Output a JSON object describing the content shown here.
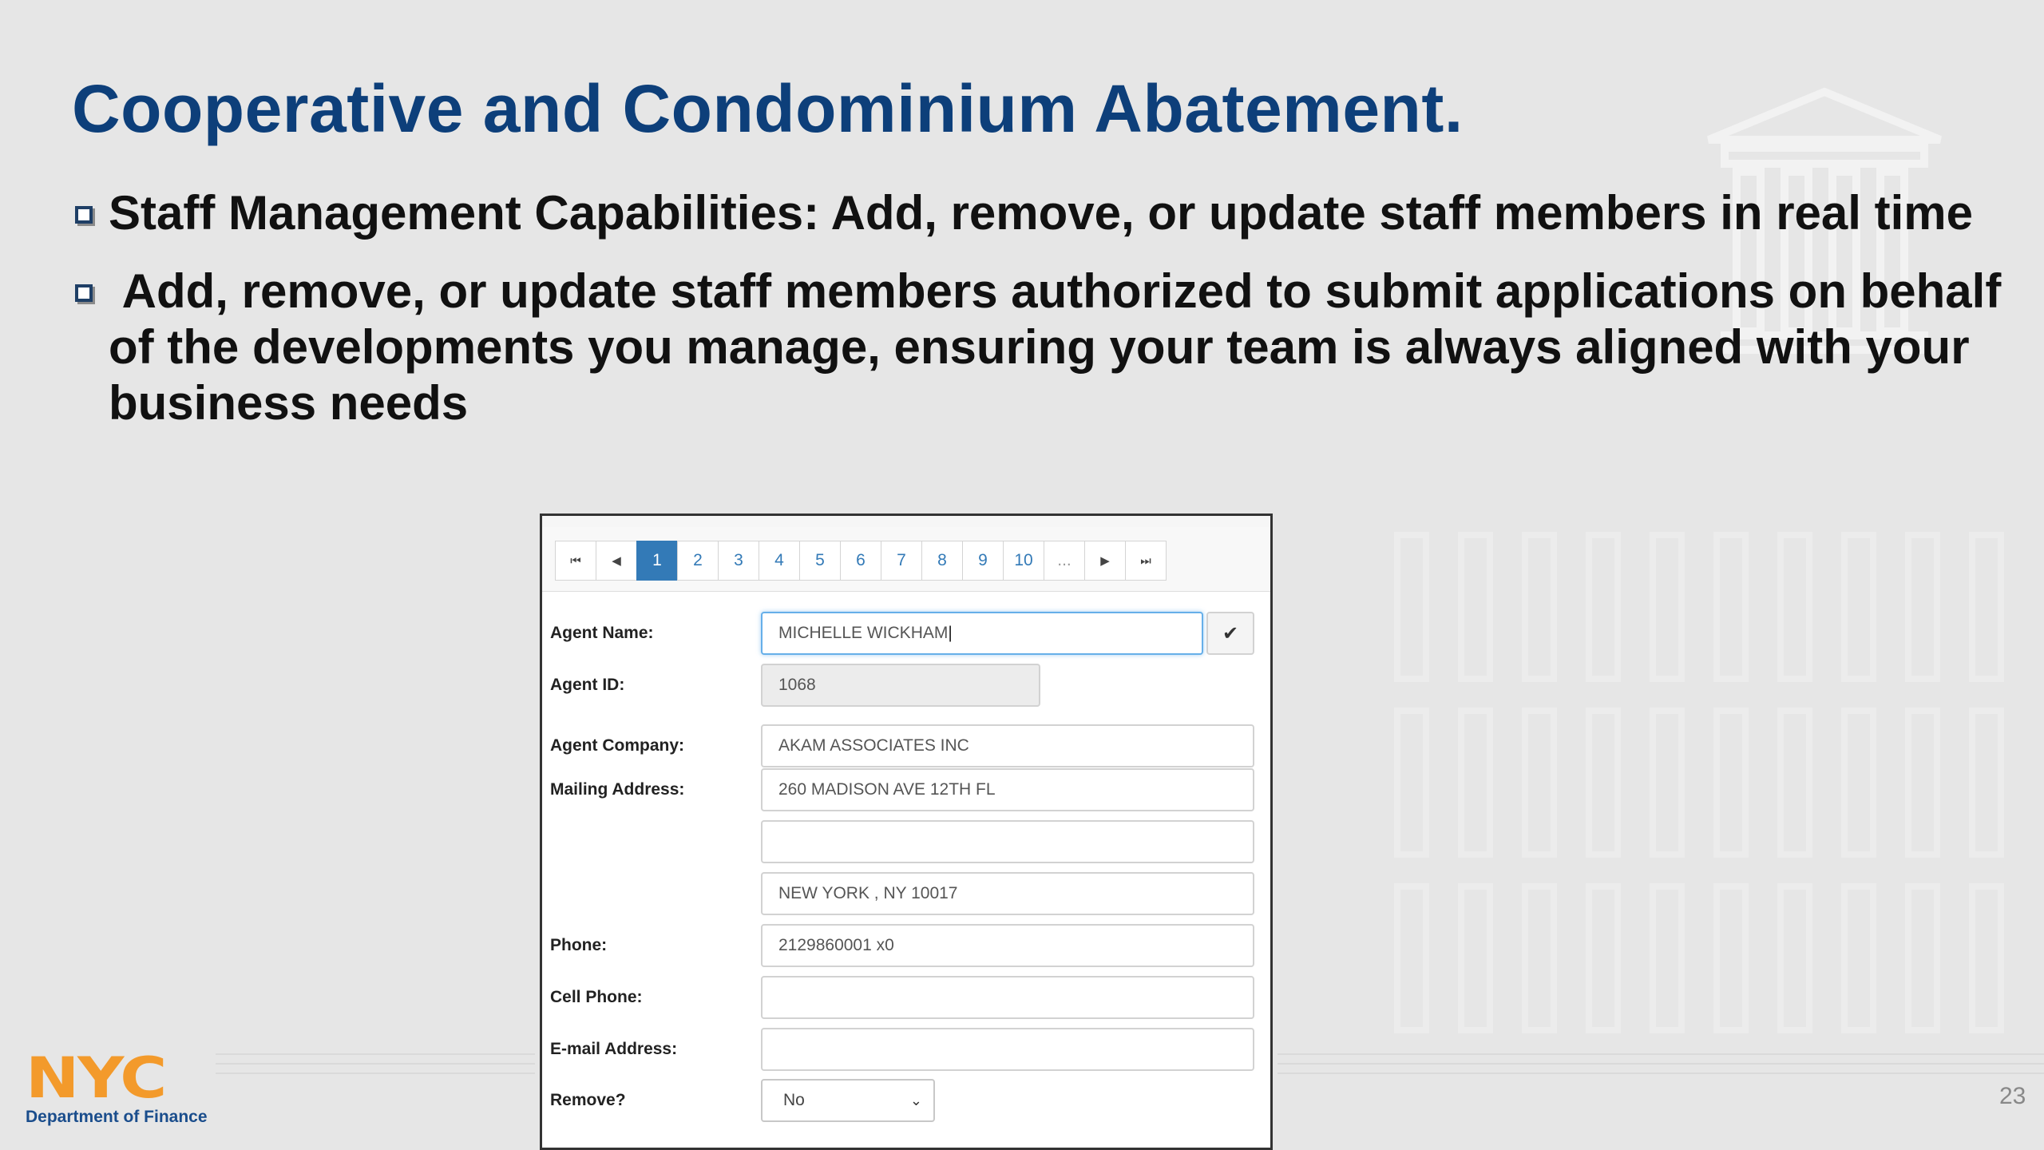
{
  "slide": {
    "title": "Cooperative and Condominium Abatement.",
    "bullets": [
      "Staff Management Capabilities: Add, remove, or update staff members in real time",
      " Add, remove, or update staff members authorized to submit applications on behalf of the developments you manage, ensuring your team is always aligned with your business needs"
    ],
    "page_number": "23"
  },
  "logo": {
    "mark": "NYC",
    "subtitle": "Department of Finance"
  },
  "pager": {
    "first": "⏮",
    "prev": "◀",
    "pages": [
      "1",
      "2",
      "3",
      "4",
      "5",
      "6",
      "7",
      "8",
      "9",
      "10"
    ],
    "active": "1",
    "ellipsis": "...",
    "next": "▶",
    "last": "⏭"
  },
  "form": {
    "agent_name_label": "Agent Name:",
    "agent_name_value": "MICHELLE WICKHAM",
    "agent_id_label": "Agent ID:",
    "agent_id_value": "1068",
    "agent_company_label": "Agent Company:",
    "agent_company_value": "AKAM ASSOCIATES INC",
    "mailing_address_label": "Mailing Address:",
    "address_line1": "260 MADISON AVE 12TH FL",
    "address_line2": "",
    "address_line3": "NEW YORK , NY 10017",
    "phone_label": "Phone:",
    "phone_value": "2129860001 x0",
    "cell_phone_label": "Cell Phone:",
    "cell_phone_value": "",
    "email_label": "E-mail Address:",
    "email_value": "",
    "remove_label": "Remove?",
    "remove_value": "No"
  },
  "colors": {
    "title": "#0d3f7a",
    "accent": "#337ab7",
    "logo_orange": "#f39a2b"
  }
}
